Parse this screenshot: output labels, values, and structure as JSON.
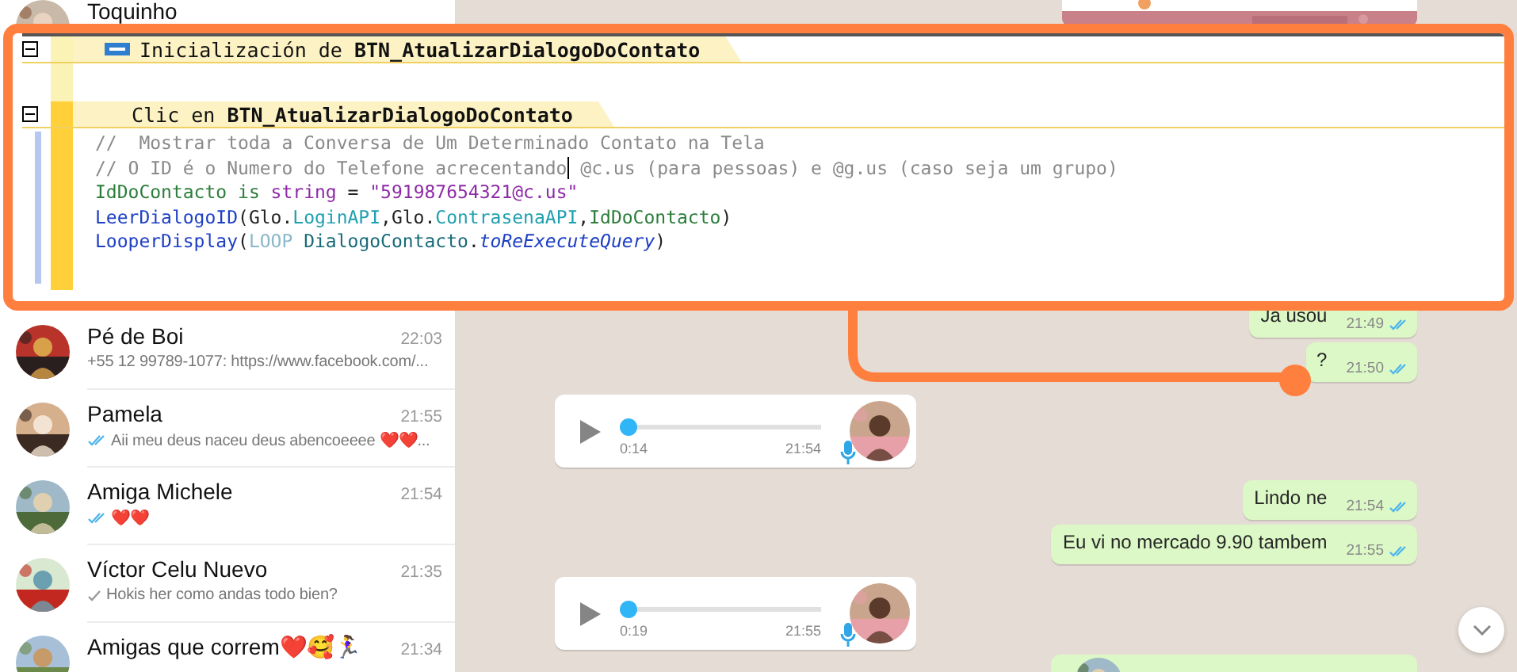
{
  "chats": [
    {
      "name": "Toquinho"
    },
    {
      "name": "Pé de Boi",
      "time": "22:03",
      "preview": "+55 12 99789-1077: https://www.facebook.com/..."
    },
    {
      "name": "Pamela",
      "time": "21:55",
      "preview": "Aii meu deus naceu deus abencoeeee ❤️❤️...",
      "read": true
    },
    {
      "name": "Amiga Michele",
      "time": "21:54",
      "preview": "❤️❤️",
      "read": true
    },
    {
      "name": "Víctor Celu Nuevo",
      "time": "21:35",
      "preview": "Hokis her como andas todo bien?",
      "read": false
    },
    {
      "name": "Amigas que correm❤️🥰🏃‍♀️",
      "time": "21:34"
    }
  ],
  "messages": [
    {
      "kind": "text",
      "outgoing": true,
      "text": "Ja usou",
      "time": "21:49",
      "read": true
    },
    {
      "kind": "text",
      "outgoing": true,
      "text": "?",
      "time": "21:50",
      "read": true
    },
    {
      "kind": "voice",
      "outgoing": false,
      "duration": "0:14",
      "time": "21:54",
      "level": 0
    },
    {
      "kind": "text",
      "outgoing": true,
      "text": "Lindo ne",
      "time": "21:54",
      "read": true
    },
    {
      "kind": "text",
      "outgoing": true,
      "text": "Eu vi no mercado 9.90 tambem",
      "time": "21:55",
      "read": true
    },
    {
      "kind": "voice",
      "outgoing": false,
      "duration": "0:19",
      "time": "21:55",
      "level": 0
    }
  ],
  "code_editor": {
    "events": [
      {
        "title": "Inicialización de **BTN_AtualizarDialogoDoContato**"
      },
      {
        "title": "Clic en **BTN_AtualizarDialogoDoContato**",
        "lines": [
          [
            {
              "kind": "comment",
              "text": "//  Mostrar toda a Conversa de Um Determinado Contato na Tela"
            }
          ],
          [
            {
              "kind": "comment",
              "text": "// O ID é o Numero do Telefone acrecentando"
            },
            {
              "kind": "caret"
            },
            {
              "kind": "comment",
              "text": " @c.us (para pessoas) e @g.us (caso seja um grupo)"
            }
          ],
          [
            {
              "kind": "variable",
              "text": "IdDoContacto"
            },
            {
              "kind": "keyword",
              "text": " is "
            },
            {
              "kind": "type",
              "text": "string"
            },
            {
              "kind": "plain",
              "text": " = "
            },
            {
              "kind": "string",
              "text": "\"591987654321@c.us\""
            }
          ],
          [
            {
              "kind": "function",
              "text": "LeerDialogoID"
            },
            {
              "kind": "plain",
              "text": "(Glo."
            },
            {
              "kind": "member",
              "text": "LoginAPI"
            },
            {
              "kind": "plain",
              "text": ",Glo."
            },
            {
              "kind": "member",
              "text": "ContrasenaAPI"
            },
            {
              "kind": "plain",
              "text": ","
            },
            {
              "kind": "variable",
              "text": "IdDoContacto"
            },
            {
              "kind": "plain",
              "text": ")"
            }
          ],
          [
            {
              "kind": "function",
              "text": "LooperDisplay"
            },
            {
              "kind": "plain",
              "text": "("
            },
            {
              "kind": "constant",
              "text": "LOOP "
            },
            {
              "kind": "object",
              "text": "DialogoContacto"
            },
            {
              "kind": "plain",
              "text": "."
            },
            {
              "kind": "property",
              "text": "toReExecuteQuery"
            },
            {
              "kind": "plain",
              "text": ")"
            }
          ]
        ]
      }
    ]
  }
}
